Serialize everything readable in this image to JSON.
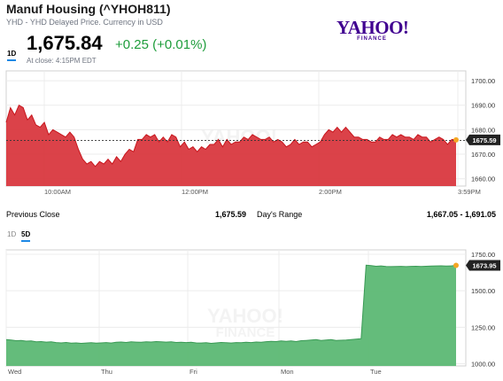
{
  "header": {
    "title": "Manuf Housing (^YHOH811)",
    "subtitle": "YHD - YHD Delayed Price. Currency in USD",
    "logo_main": "YAHOO!",
    "logo_sub": "FINANCE",
    "price": "1,675.84",
    "change": "+0.25 (+0.01%)",
    "close_note": "At close: 4:15PM EDT"
  },
  "colors": {
    "intraday_fill": "#d9383f",
    "intraday_line": "#c8161d",
    "fiveday_fill": "#5cb874",
    "fiveday_line": "#3a9a55",
    "positive": "#1e9d3b",
    "marker": "#f5a623"
  },
  "tabs_top": [
    {
      "label": "1D",
      "active": true
    }
  ],
  "tabs_bottom": [
    {
      "label": "1D",
      "active": false
    },
    {
      "label": "5D",
      "active": true
    }
  ],
  "stats": {
    "prev_close_label": "Previous Close",
    "prev_close_value": "1,675.59",
    "days_range_label": "Day's Range",
    "days_range_value": "1,667.05 - 1,691.05"
  },
  "chart_data": [
    {
      "type": "area",
      "name": "intraday",
      "x_labels": [
        "10:00AM",
        "12:00PM",
        "2:00PM",
        "3:59PM"
      ],
      "y_ticks": [
        1660,
        1670,
        1680,
        1690,
        1700
      ],
      "y_tick_labels": [
        "1660.00",
        "1670.00",
        "1680.00",
        "1690.00",
        "1700.00"
      ],
      "ylim": [
        1657,
        1704
      ],
      "reference_line": 1675.59,
      "last_label": "1675.59",
      "watermark": "YAHOO!",
      "values": [
        1683,
        1689,
        1686,
        1690,
        1689,
        1684,
        1686,
        1682,
        1681,
        1683,
        1678,
        1680,
        1679,
        1678,
        1677,
        1679,
        1677,
        1672,
        1668,
        1666,
        1667,
        1665,
        1667,
        1666,
        1668,
        1666,
        1669,
        1667,
        1670,
        1672,
        1671,
        1676,
        1676,
        1678,
        1677,
        1678,
        1675,
        1677,
        1675,
        1678,
        1677,
        1673,
        1675,
        1672,
        1673,
        1671,
        1673,
        1672,
        1674,
        1674,
        1676,
        1673,
        1676,
        1674,
        1675,
        1675,
        1677,
        1676,
        1678,
        1677,
        1676,
        1676,
        1677,
        1675,
        1676,
        1675,
        1673,
        1674,
        1676,
        1674,
        1675,
        1675,
        1673,
        1674,
        1675,
        1678,
        1680,
        1679,
        1681,
        1679,
        1681,
        1679,
        1677,
        1677,
        1676,
        1676,
        1675,
        1675,
        1677,
        1676,
        1676,
        1678,
        1677,
        1678,
        1677,
        1677,
        1676,
        1678,
        1677,
        1677,
        1675,
        1676,
        1677,
        1676,
        1674,
        1676,
        1675.84
      ]
    },
    {
      "type": "area",
      "name": "5-day",
      "x_labels": [
        "Wed",
        "Thu",
        "Fri",
        "Mon",
        "Tue"
      ],
      "y_ticks": [
        1000,
        1250,
        1500,
        1750
      ],
      "y_tick_labels": [
        "1000.00",
        "1250.00",
        "1500.00",
        "1750.00"
      ],
      "ylim": [
        985,
        1780
      ],
      "last_label": "1673.95",
      "watermark_main": "YAHOO!",
      "watermark_sub": "FINANCE",
      "values": [
        1165,
        1162,
        1158,
        1160,
        1155,
        1157,
        1150,
        1152,
        1148,
        1150,
        1145,
        1143,
        1146,
        1141,
        1143,
        1140,
        1142,
        1144,
        1141,
        1143,
        1145,
        1142,
        1147,
        1149,
        1146,
        1150,
        1148,
        1147,
        1150,
        1149,
        1152,
        1150,
        1148,
        1150,
        1146,
        1147,
        1145,
        1147,
        1143,
        1142,
        1144,
        1140,
        1143,
        1146,
        1144,
        1142,
        1145,
        1144,
        1147,
        1145,
        1149,
        1147,
        1151,
        1153,
        1152,
        1156,
        1154,
        1157,
        1152,
        1158,
        1160,
        1162,
        1165,
        1160,
        1163,
        1165,
        1160,
        1161,
        1162,
        1165,
        1168,
        1172,
        1675,
        1672,
        1668,
        1670,
        1666,
        1665,
        1666,
        1667,
        1665,
        1667,
        1668,
        1666,
        1668,
        1669,
        1670,
        1671,
        1669,
        1670,
        1673.95
      ]
    }
  ]
}
